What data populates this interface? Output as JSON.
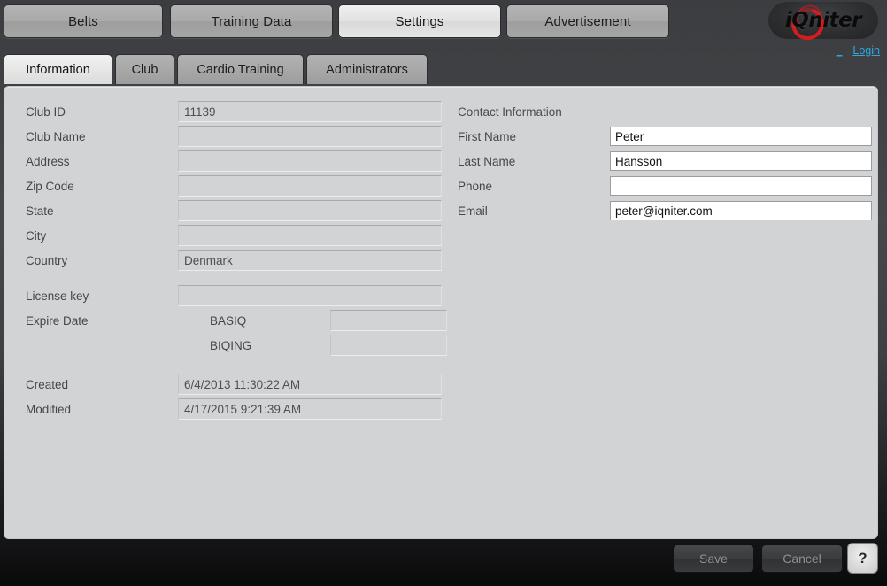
{
  "brand": {
    "logo_text": "iQniter",
    "login_label": "Login",
    "login_prefix": "_",
    "accent_link_color": "#2ea8e0",
    "accent_logo_color": "#d81b1f"
  },
  "topnav": {
    "items": [
      {
        "label": "Belts",
        "active": false
      },
      {
        "label": "Training Data",
        "active": false
      },
      {
        "label": "Settings",
        "active": true
      },
      {
        "label": "Advertisement",
        "active": false
      }
    ]
  },
  "subtabs": {
    "items": [
      {
        "label": "Information",
        "active": true
      },
      {
        "label": "Club",
        "active": false
      },
      {
        "label": "Cardio Training",
        "active": false
      },
      {
        "label": "Administrators",
        "active": false
      }
    ]
  },
  "form": {
    "left": {
      "club_id": {
        "label": "Club ID",
        "value": "11139"
      },
      "club_name": {
        "label": "Club Name",
        "value": ""
      },
      "address": {
        "label": "Address",
        "value": ""
      },
      "zip_code": {
        "label": "Zip Code",
        "value": ""
      },
      "state": {
        "label": "State",
        "value": ""
      },
      "city": {
        "label": "City",
        "value": ""
      },
      "country": {
        "label": "Country",
        "value": "Denmark"
      },
      "license_key": {
        "label": "License key",
        "value": ""
      },
      "expire_date": {
        "label": "Expire Date",
        "rows": [
          {
            "label": "BASIQ",
            "value": ""
          },
          {
            "label": "BIQING",
            "value": ""
          }
        ]
      },
      "created": {
        "label": "Created",
        "value": "6/4/2013 11:30:22 AM"
      },
      "modified": {
        "label": "Modified",
        "value": "4/17/2015 9:21:39 AM"
      }
    },
    "right": {
      "section_title": "Contact Information",
      "first_name": {
        "label": "First Name",
        "value": "Peter",
        "placeholder": ""
      },
      "last_name": {
        "label": "Last Name",
        "value": "Hansson",
        "placeholder": ""
      },
      "phone": {
        "label": "Phone",
        "value": "",
        "placeholder": ""
      },
      "email": {
        "label": "Email",
        "value": "peter@iqniter.com",
        "placeholder": ""
      }
    }
  },
  "footer": {
    "save_label": "Save",
    "cancel_label": "Cancel",
    "help_label": "?"
  }
}
